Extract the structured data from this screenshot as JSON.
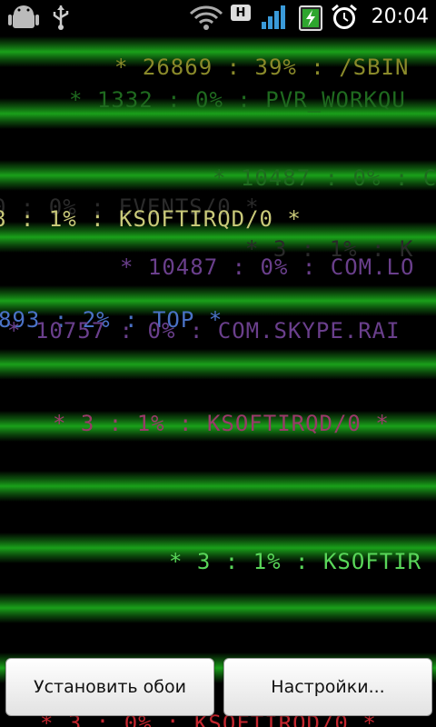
{
  "status_bar": {
    "time": "20:04",
    "network_type": "H",
    "icons": [
      "android-icon",
      "usb-icon",
      "wifi-icon",
      "network-h-icon",
      "signal-icon",
      "battery-charging-icon",
      "alarm-icon"
    ]
  },
  "terminal_lines": [
    "* 26869 : 39% : /SBIN",
    "* 1332 : 0% : PVR_WORKQU",
    "* 10487 : 0% : C",
    "8 : 1% : KSOFTIRQD/0 *",
    "* 10487 : 0% : COM.LO",
    "893 : 2% : TOP *",
    "* 10757 : 0% : COM.SKYPE.RAI",
    "* 3 : 1% : KSOFTIRQD/0 *",
    "* 3 : 1% : KSOFTIR",
    "* 3 : 0% : KSOFTIRQD/0 *"
  ],
  "ghost_lines": [
    "0 : 0% : EVENTS/0 *",
    "* 3 : 1% : K"
  ],
  "colors": {
    "scan_green": "#1aa01a",
    "text_olive": "#8a8a2a",
    "text_dim_green": "#1f6a1f",
    "text_khaki": "#c9c979",
    "text_purple": "#6a3f8c",
    "text_blue": "#4a72c6",
    "text_pink": "#9a3a6a",
    "text_bright_green": "#59d659",
    "text_red": "#c4262e"
  },
  "buttons": {
    "set_wallpaper": "Установить обои",
    "settings": "Настройки..."
  }
}
